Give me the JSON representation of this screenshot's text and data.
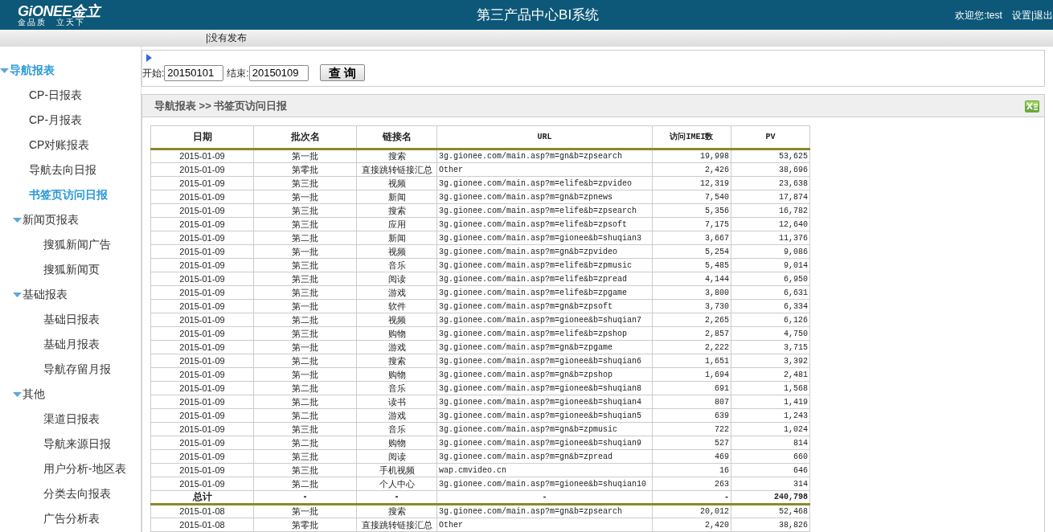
{
  "header": {
    "logo": "GiONEE金立",
    "slogan": "金品质　立天下",
    "title": "第三产品中心BI系统",
    "welcome": "欢迎您:test",
    "links": "设置|退出"
  },
  "notice": "|没有发布",
  "sidebar": {
    "items": [
      {
        "label": "导航报表",
        "expanded": true,
        "children": [
          {
            "label": "CP-日报表",
            "selected": false
          },
          {
            "label": "CP-月报表",
            "selected": false
          },
          {
            "label": "CP对账报表",
            "selected": false
          },
          {
            "label": "导航去向日报",
            "selected": false
          },
          {
            "label": "书签页访问日报",
            "selected": true
          },
          {
            "label": "新闻页报表",
            "expanded": true,
            "children": [
              {
                "label": "搜狐新闻广告",
                "selected": false
              },
              {
                "label": "搜狐新闻页",
                "selected": false
              }
            ]
          },
          {
            "label": "基础报表",
            "expanded": true,
            "children": [
              {
                "label": "基础日报表",
                "selected": false
              },
              {
                "label": "基础月报表",
                "selected": false
              },
              {
                "label": "导航存留月报",
                "selected": false
              }
            ]
          },
          {
            "label": "其他",
            "expanded": true,
            "children": [
              {
                "label": "渠道日报表",
                "selected": false
              },
              {
                "label": "导航来源日报",
                "selected": false
              },
              {
                "label": "用户分析-地区表",
                "selected": false
              },
              {
                "label": "分类去向报表",
                "selected": false
              },
              {
                "label": "广告分析表",
                "selected": false
              }
            ]
          }
        ]
      }
    ]
  },
  "query": {
    "start_label": "开始:",
    "start": "20150101",
    "end_label": "结束:",
    "end": "20150109",
    "button": "查 询"
  },
  "report": {
    "breadcrumb": "导航报表 >> 书签页访问日报",
    "table": {
      "columns": [
        "日期",
        "批次名",
        "链接名",
        "URL",
        "访问IMEI数",
        "PV"
      ],
      "rows": [
        {
          "kind": "data",
          "cells": [
            "2015-01-09",
            "第一批",
            "搜索",
            "3g.gionee.com/main.asp?m=gn&b=zpsearch",
            "19,998",
            "53,625"
          ]
        },
        {
          "kind": "data",
          "cells": [
            "2015-01-09",
            "第零批",
            "直接跳转链接汇总",
            "Other",
            "2,426",
            "38,696"
          ]
        },
        {
          "kind": "data",
          "cells": [
            "2015-01-09",
            "第三批",
            "视频",
            "3g.gionee.com/main.asp?m=elife&b=zpvideo",
            "12,319",
            "23,638"
          ]
        },
        {
          "kind": "data",
          "cells": [
            "2015-01-09",
            "第一批",
            "新闻",
            "3g.gionee.com/main.asp?m=gn&b=zpnews",
            "7,540",
            "17,874"
          ]
        },
        {
          "kind": "data",
          "cells": [
            "2015-01-09",
            "第三批",
            "搜索",
            "3g.gionee.com/main.asp?m=elife&b=zpsearch",
            "5,356",
            "16,782"
          ]
        },
        {
          "kind": "data",
          "cells": [
            "2015-01-09",
            "第三批",
            "应用",
            "3g.gionee.com/main.asp?m=elife&b=zpsoft",
            "7,175",
            "12,640"
          ]
        },
        {
          "kind": "data",
          "cells": [
            "2015-01-09",
            "第二批",
            "新闻",
            "3g.gionee.com/main.asp?m=gionee&b=shuqian3",
            "3,667",
            "11,376"
          ]
        },
        {
          "kind": "data",
          "cells": [
            "2015-01-09",
            "第一批",
            "视频",
            "3g.gionee.com/main.asp?m=gn&b=zpvideo",
            "5,254",
            "9,086"
          ]
        },
        {
          "kind": "data",
          "cells": [
            "2015-01-09",
            "第三批",
            "音乐",
            "3g.gionee.com/main.asp?m=elife&b=zpmusic",
            "5,485",
            "9,014"
          ]
        },
        {
          "kind": "data",
          "cells": [
            "2015-01-09",
            "第三批",
            "阅读",
            "3g.gionee.com/main.asp?m=elife&b=zpread",
            "4,144",
            "6,950"
          ]
        },
        {
          "kind": "data",
          "cells": [
            "2015-01-09",
            "第三批",
            "游戏",
            "3g.gionee.com/main.asp?m=elife&b=zpgame",
            "3,800",
            "6,631"
          ]
        },
        {
          "kind": "data",
          "cells": [
            "2015-01-09",
            "第一批",
            "软件",
            "3g.gionee.com/main.asp?m=gn&b=zpsoft",
            "3,730",
            "6,334"
          ]
        },
        {
          "kind": "data",
          "cells": [
            "2015-01-09",
            "第二批",
            "视频",
            "3g.gionee.com/main.asp?m=gionee&b=shuqian7",
            "2,265",
            "6,126"
          ]
        },
        {
          "kind": "data",
          "cells": [
            "2015-01-09",
            "第三批",
            "购物",
            "3g.gionee.com/main.asp?m=elife&b=zpshop",
            "2,857",
            "4,750"
          ]
        },
        {
          "kind": "data",
          "cells": [
            "2015-01-09",
            "第一批",
            "游戏",
            "3g.gionee.com/main.asp?m=gn&b=zpgame",
            "2,222",
            "3,715"
          ]
        },
        {
          "kind": "data",
          "cells": [
            "2015-01-09",
            "第二批",
            "搜索",
            "3g.gionee.com/main.asp?m=gionee&b=shuqian6",
            "1,651",
            "3,392"
          ]
        },
        {
          "kind": "data",
          "cells": [
            "2015-01-09",
            "第一批",
            "购物",
            "3g.gionee.com/main.asp?m=gn&b=zpshop",
            "1,694",
            "2,481"
          ]
        },
        {
          "kind": "data",
          "cells": [
            "2015-01-09",
            "第二批",
            "音乐",
            "3g.gionee.com/main.asp?m=gionee&b=shuqian8",
            "691",
            "1,568"
          ]
        },
        {
          "kind": "data",
          "cells": [
            "2015-01-09",
            "第二批",
            "读书",
            "3g.gionee.com/main.asp?m=gionee&b=shuqian4",
            "807",
            "1,419"
          ]
        },
        {
          "kind": "data",
          "cells": [
            "2015-01-09",
            "第二批",
            "游戏",
            "3g.gionee.com/main.asp?m=gionee&b=shuqian5",
            "639",
            "1,243"
          ]
        },
        {
          "kind": "data",
          "cells": [
            "2015-01-09",
            "第三批",
            "音乐",
            "3g.gionee.com/main.asp?m=gn&b=zpmusic",
            "722",
            "1,024"
          ]
        },
        {
          "kind": "data",
          "cells": [
            "2015-01-09",
            "第二批",
            "购物",
            "3g.gionee.com/main.asp?m=gionee&b=shuqian9",
            "527",
            "814"
          ]
        },
        {
          "kind": "data",
          "cells": [
            "2015-01-09",
            "第三批",
            "阅读",
            "3g.gionee.com/main.asp?m=gn&b=zpread",
            "469",
            "660"
          ]
        },
        {
          "kind": "data",
          "cells": [
            "2015-01-09",
            "第三批",
            "手机视频",
            "wap.cmvideo.cn",
            "16",
            "646"
          ]
        },
        {
          "kind": "data",
          "cells": [
            "2015-01-09",
            "第二批",
            "个人中心",
            "3g.gionee.com/main.asp?m=gionee&b=shuqian10",
            "263",
            "314"
          ]
        },
        {
          "kind": "total",
          "cells": [
            "总计",
            "-",
            "-",
            "-",
            "-",
            "240,798"
          ]
        },
        {
          "kind": "data",
          "cells": [
            "2015-01-08",
            "第一批",
            "搜索",
            "3g.gionee.com/main.asp?m=gn&b=zpsearch",
            "20,012",
            "52,468"
          ]
        },
        {
          "kind": "data",
          "cells": [
            "2015-01-08",
            "第零批",
            "直接跳转链接汇总",
            "Other",
            "2,420",
            "38,826"
          ]
        }
      ]
    }
  }
}
